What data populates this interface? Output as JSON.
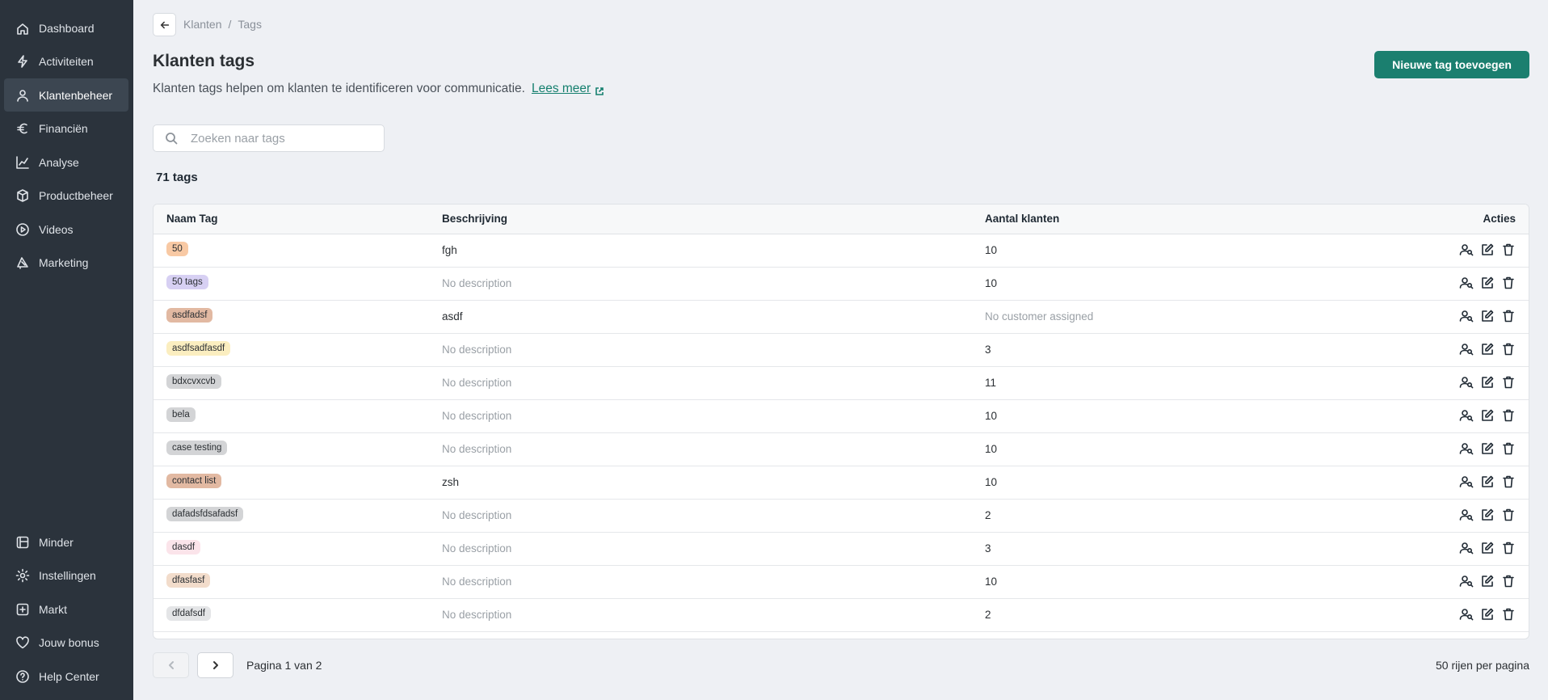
{
  "sidebar": {
    "items": [
      {
        "label": "Dashboard",
        "icon": "home-icon"
      },
      {
        "label": "Activiteiten",
        "icon": "bolt-icon"
      },
      {
        "label": "Klantenbeheer",
        "icon": "user-icon",
        "active": true
      },
      {
        "label": "Financiën",
        "icon": "euro-icon"
      },
      {
        "label": "Analyse",
        "icon": "chart-line-icon"
      },
      {
        "label": "Productbeheer",
        "icon": "box-icon"
      },
      {
        "label": "Videos",
        "icon": "play-icon"
      },
      {
        "label": "Marketing",
        "icon": "megaphone-icon"
      }
    ],
    "bottom_items": [
      {
        "label": "Minder",
        "icon": "collapse-icon"
      },
      {
        "label": "Instellingen",
        "icon": "gear-icon"
      },
      {
        "label": "Markt",
        "icon": "plus-square-icon"
      },
      {
        "label": "Jouw bonus",
        "icon": "heart-icon"
      },
      {
        "label": "Help Center",
        "icon": "help-icon"
      }
    ]
  },
  "breadcrumb": {
    "parent": "Klanten",
    "separator": "/",
    "current": "Tags"
  },
  "header": {
    "title": "Klanten tags",
    "subtitle": "Klanten tags helpen om klanten te identificeren voor communicatie.",
    "learn_more": "Lees meer",
    "add_button": "Nieuwe tag toevoegen"
  },
  "search": {
    "placeholder": "Zoeken naar tags",
    "value": ""
  },
  "count_label": "71 tags",
  "table": {
    "columns": [
      "Naam Tag",
      "Beschrijving",
      "Aantal klanten",
      "Acties"
    ],
    "rows": [
      {
        "tag": "50",
        "tag_color": "#f8c9a4",
        "description": "fgh",
        "desc_muted": false,
        "customers": "10",
        "cust_muted": false
      },
      {
        "tag": "50 tags",
        "tag_color": "#d7d0f3",
        "description": "No description",
        "desc_muted": true,
        "customers": "10",
        "cust_muted": false
      },
      {
        "tag": "asdfadsf",
        "tag_color": "#e2b9a2",
        "description": "asdf",
        "desc_muted": false,
        "customers": "No customer assigned",
        "cust_muted": true
      },
      {
        "tag": "asdfsadfasdf",
        "tag_color": "#fbeec0",
        "description": "No description",
        "desc_muted": true,
        "customers": "3",
        "cust_muted": false
      },
      {
        "tag": "bdxcvxcvb",
        "tag_color": "#d3d4d6",
        "description": "No description",
        "desc_muted": true,
        "customers": "11",
        "cust_muted": false
      },
      {
        "tag": "bela",
        "tag_color": "#d3d4d6",
        "description": "No description",
        "desc_muted": true,
        "customers": "10",
        "cust_muted": false
      },
      {
        "tag": "case testing",
        "tag_color": "#d3d4d6",
        "description": "No description",
        "desc_muted": true,
        "customers": "10",
        "cust_muted": false
      },
      {
        "tag": "contact list",
        "tag_color": "#e2b9a2",
        "description": "zsh",
        "desc_muted": false,
        "customers": "10",
        "cust_muted": false
      },
      {
        "tag": "dafadsfdsafadsf",
        "tag_color": "#d3d4d6",
        "description": "No description",
        "desc_muted": true,
        "customers": "2",
        "cust_muted": false
      },
      {
        "tag": "dasdf",
        "tag_color": "#fbe4ea",
        "description": "No description",
        "desc_muted": true,
        "customers": "3",
        "cust_muted": false
      },
      {
        "tag": "dfasfasf",
        "tag_color": "#f2dccb",
        "description": "No description",
        "desc_muted": true,
        "customers": "10",
        "cust_muted": false
      },
      {
        "tag": "dfdafsdf",
        "tag_color": "#e4e5e7",
        "description": "No description",
        "desc_muted": true,
        "customers": "2",
        "cust_muted": false
      }
    ]
  },
  "pagination": {
    "page_info": "Pagina 1 van 2",
    "per_page": "50 rijen per pagina"
  },
  "colors": {
    "sidebar_bg": "#2b333c",
    "accent": "#1b7f6f",
    "page_bg": "#eef0f4"
  }
}
